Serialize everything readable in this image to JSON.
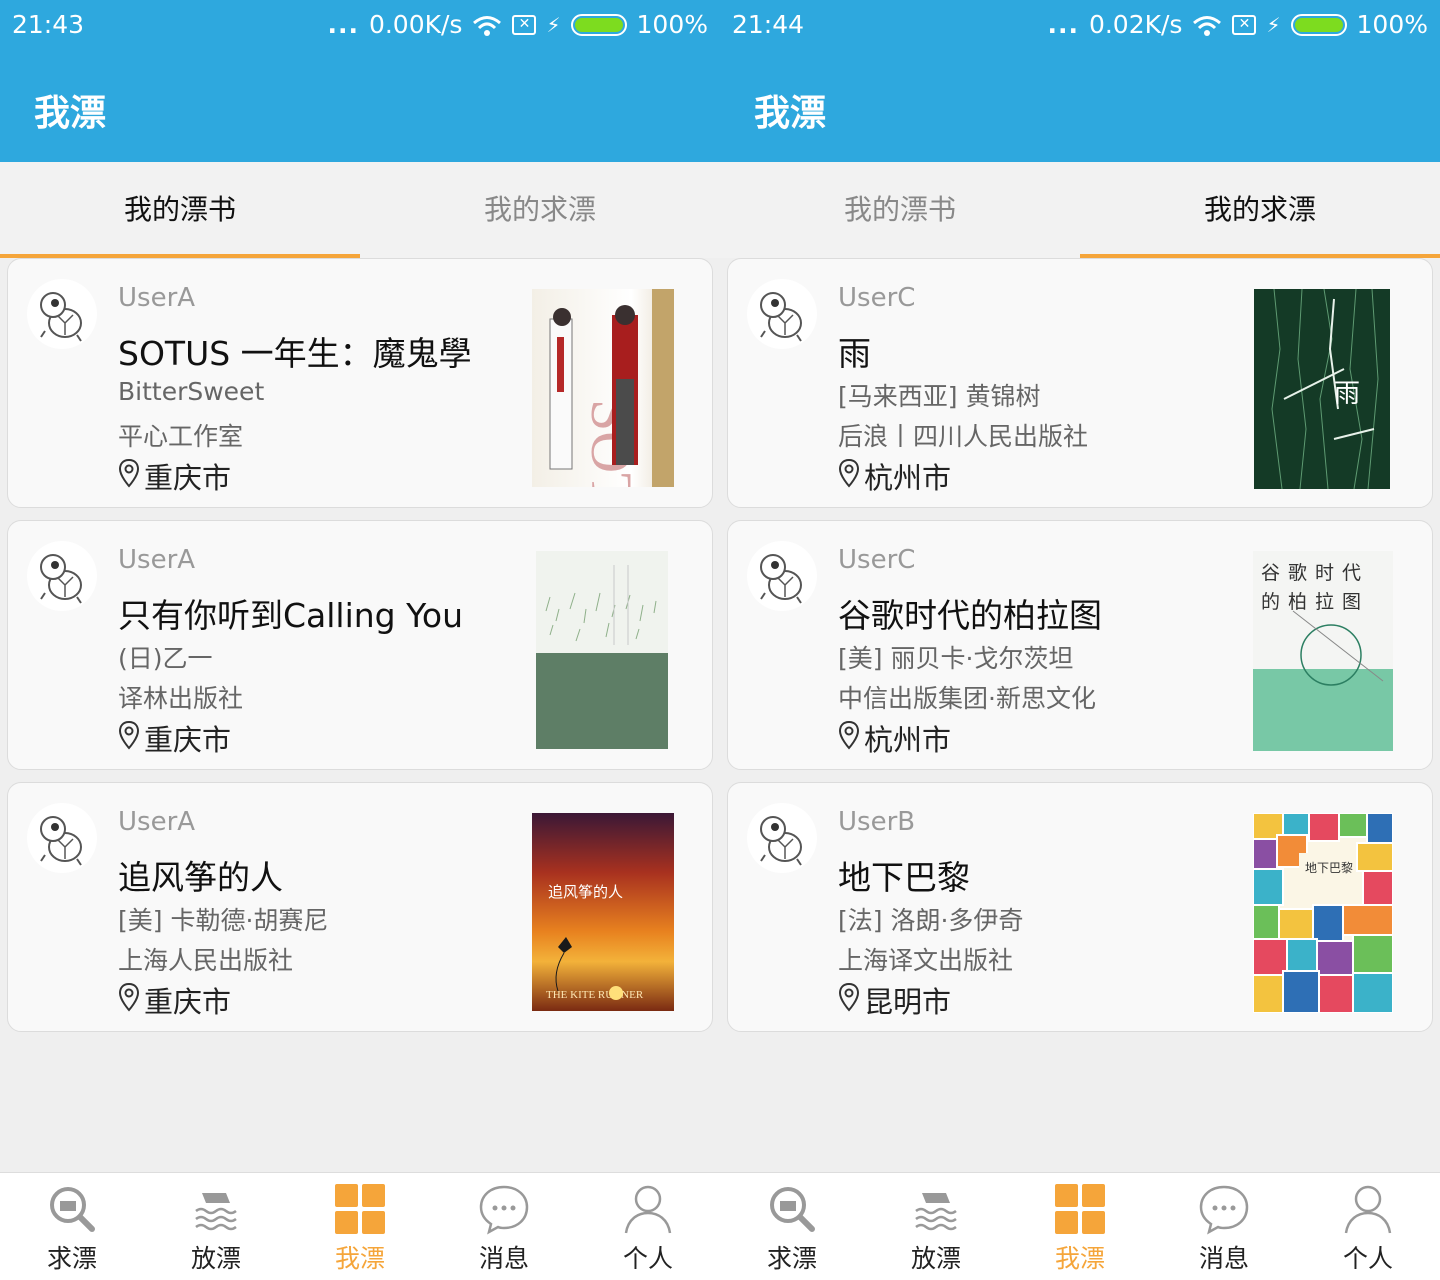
{
  "screens": [
    {
      "status": {
        "time": "21:43",
        "dots": "...",
        "speed": "0.00K/s",
        "battery": "100%"
      },
      "title": "我漂",
      "tabs": [
        {
          "label": "我的漂书",
          "active": true
        },
        {
          "label": "我的求漂",
          "active": false
        }
      ],
      "cards": [
        {
          "user": "UserA",
          "title": "SOTUS  一年生：魔鬼學",
          "author": "BitterSweet",
          "publisher": "平心工作室",
          "location": "重庆市",
          "cover": "sotus-cover"
        },
        {
          "user": "UserA",
          "title": "只有你听到Calling You",
          "author": "(日)乙一",
          "publisher": "译林出版社",
          "location": "重庆市",
          "cover": "calling-you-cover"
        },
        {
          "user": "UserA",
          "title": "追风筝的人",
          "author": "[美] 卡勒德·胡赛尼",
          "publisher": "上海人民出版社",
          "location": "重庆市",
          "cover": "kite-runner-cover",
          "cover_text": "追风筝的人",
          "cover_subtext": "THE KITE RUNNER"
        }
      ],
      "nav": [
        {
          "label": "求漂",
          "icon": "search-book-icon"
        },
        {
          "label": "放漂",
          "icon": "book-stack-icon"
        },
        {
          "label": "我漂",
          "icon": "grid-icon",
          "active": true
        },
        {
          "label": "消息",
          "icon": "chat-bubble-icon"
        },
        {
          "label": "个人",
          "icon": "person-icon"
        }
      ]
    },
    {
      "status": {
        "time": "21:44",
        "dots": "...",
        "speed": "0.02K/s",
        "battery": "100%"
      },
      "title": "我漂",
      "tabs": [
        {
          "label": "我的漂书",
          "active": false
        },
        {
          "label": "我的求漂",
          "active": true
        }
      ],
      "cards": [
        {
          "user": "UserC",
          "title": "雨",
          "author": "[马来西亚] 黄锦树",
          "publisher": "后浪丨四川人民出版社",
          "location": "杭州市",
          "cover": "rain-cover",
          "cover_text": "雨"
        },
        {
          "user": "UserC",
          "title": "谷歌时代的柏拉图",
          "author": "[美] 丽贝卡·戈尔茨坦",
          "publisher": "中信出版集团·新思文化",
          "location": "杭州市",
          "cover": "plato-cover",
          "cover_text": "谷歌时代的柏拉图"
        },
        {
          "user": "UserB",
          "title": "地下巴黎",
          "author": "[法] 洛朗·多伊奇",
          "publisher": "上海译文出版社",
          "location": "昆明市",
          "cover": "paris-cover",
          "cover_text": "地下巴黎"
        }
      ],
      "nav": [
        {
          "label": "求漂",
          "icon": "search-book-icon"
        },
        {
          "label": "放漂",
          "icon": "book-stack-icon"
        },
        {
          "label": "我漂",
          "icon": "grid-icon",
          "active": true
        },
        {
          "label": "消息",
          "icon": "chat-bubble-icon"
        },
        {
          "label": "个人",
          "icon": "person-icon"
        }
      ]
    }
  ],
  "colors": {
    "appbar": "#2ea8de",
    "accent": "#f5a53a",
    "battery": "#7ddc1f"
  }
}
